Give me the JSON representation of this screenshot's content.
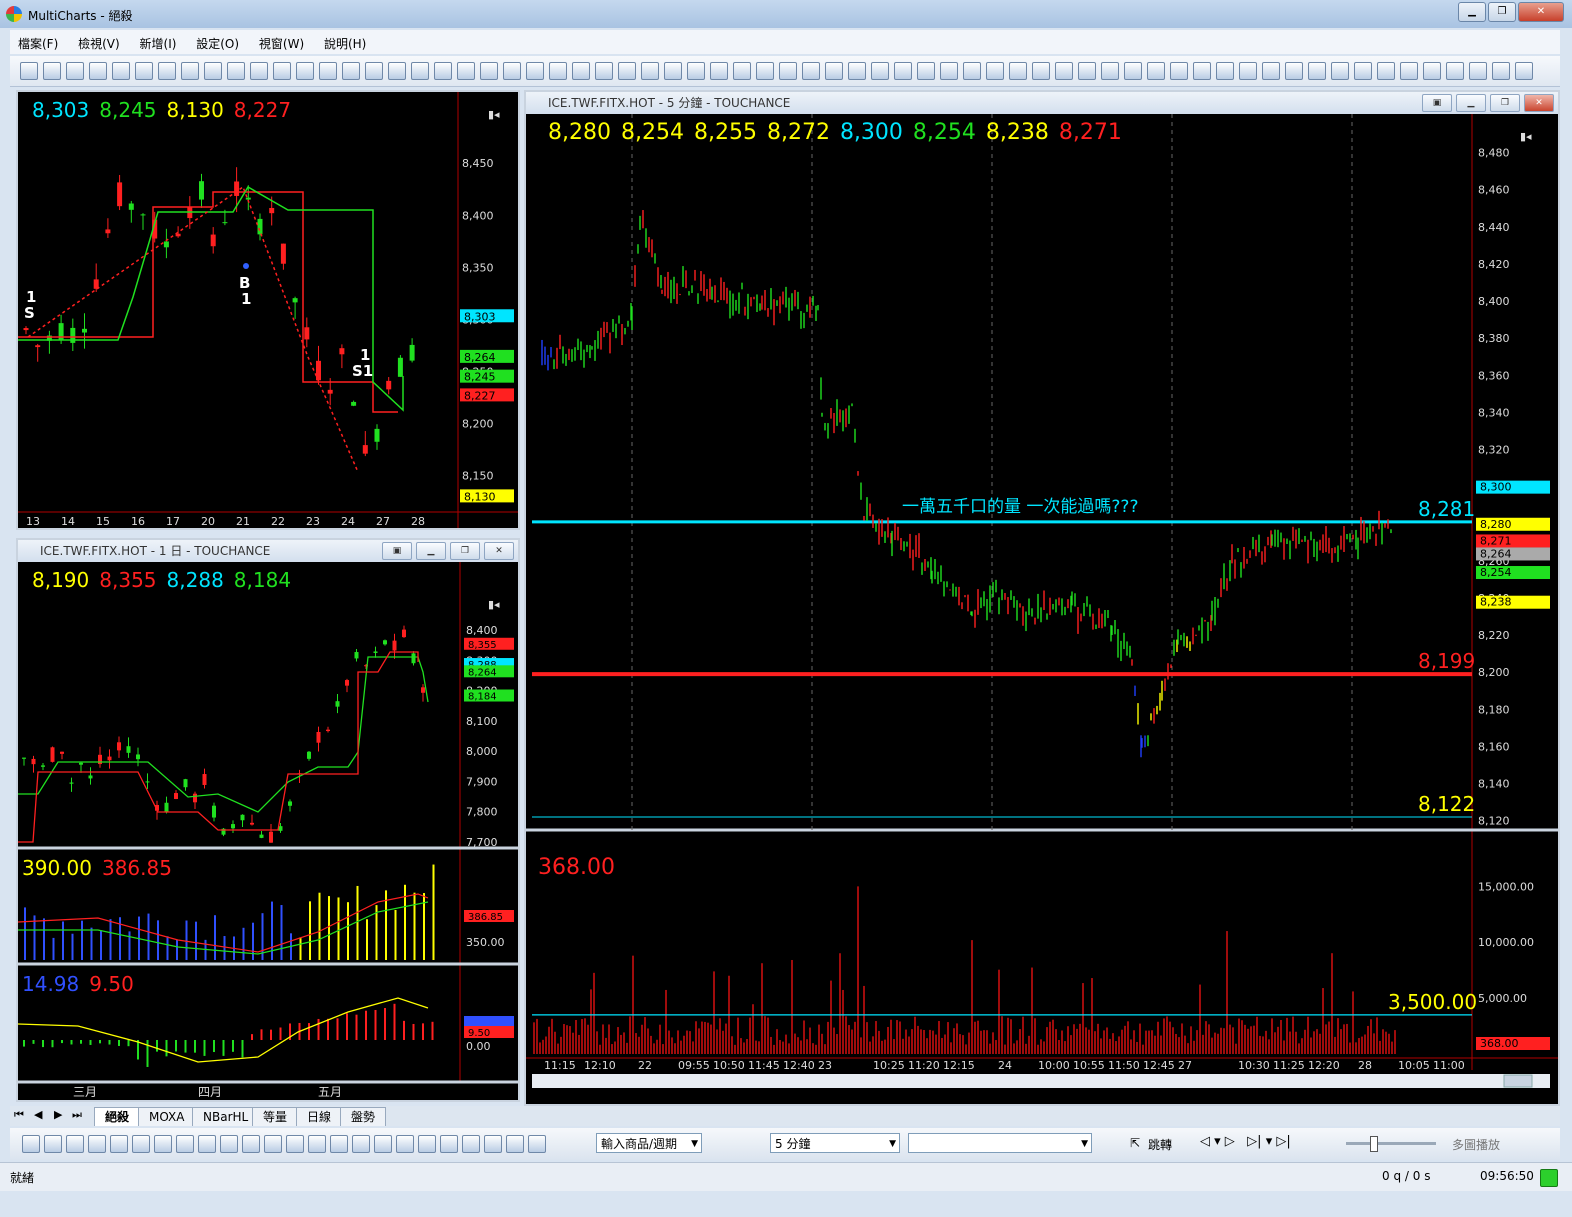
{
  "window": {
    "title": "MultiCharts - 絕殺"
  },
  "menu": [
    "檔案(F)",
    "檢視(V)",
    "新增(I)",
    "設定(O)",
    "視窗(W)",
    "說明(H)"
  ],
  "chart_top_left": {
    "ohlc": [
      "8,303",
      "8,245",
      "8,130",
      "8,227"
    ],
    "ohlc_colors": [
      "#00e5ff",
      "#20e020",
      "#ffff00",
      "#ff2020"
    ],
    "price_ticks": [
      "8,450",
      "8,400",
      "8,350",
      "8,300",
      "8,250",
      "8,200",
      "8,150"
    ],
    "price_tags": [
      "8,303",
      "8,264",
      "8,245",
      "8,227",
      "8,130"
    ],
    "date_ticks": [
      "13",
      "14",
      "15",
      "16",
      "17",
      "20",
      "21",
      "22",
      "23",
      "24",
      "27",
      "28"
    ],
    "signals": [
      "1",
      "S",
      "B",
      "1",
      "1",
      "S1"
    ]
  },
  "chart_daily": {
    "title": "ICE.TWF.FITX.HOT - 1 日 - TOUCHANCE",
    "ohlc": [
      "8,190",
      "8,355",
      "8,288",
      "8,184"
    ],
    "ohlc_colors": [
      "#ffff00",
      "#ff2020",
      "#00e5ff",
      "#20e020"
    ],
    "price_ticks": [
      "8,400",
      "8,300",
      "8,200",
      "8,100",
      "8,000",
      "7,900",
      "7,800",
      "7,700"
    ],
    "price_tags": [
      "8,355",
      "8,288",
      "8,264",
      "8,184"
    ],
    "volume_header": [
      "390.00",
      "386.85"
    ],
    "volume_tags": [
      "386.85"
    ],
    "volume_ticks": [
      "350.00"
    ],
    "osc_header": [
      "14.98",
      "9.50"
    ],
    "osc_tags": [
      "14.98",
      "9.50"
    ],
    "osc_ticks": [
      "0.00"
    ],
    "month_ticks": [
      "三月",
      "四月",
      "五月"
    ]
  },
  "chart_main": {
    "title": "ICE.TWF.FITX.HOT - 5 分鐘 - TOUCHANCE",
    "ohlc": [
      "8,280",
      "8,254",
      "8,255",
      "8,272",
      "8,300",
      "8,254",
      "8,238",
      "8,271"
    ],
    "ohlc_colors": [
      "#ffff00",
      "#ffff00",
      "#ffff00",
      "#ffff00",
      "#00e5ff",
      "#20e020",
      "#ffff00",
      "#ff2020"
    ],
    "price_ticks": [
      "8,480",
      "8,460",
      "8,440",
      "8,420",
      "8,400",
      "8,380",
      "8,360",
      "8,340",
      "8,320",
      "8,300",
      "8,280",
      "8,260",
      "8,240",
      "8,220",
      "8,200",
      "8,180",
      "8,160",
      "8,140",
      "8,120"
    ],
    "price_tags": [
      "8,300",
      "8,280",
      "8,271",
      "8,264",
      "8,254",
      "8,238"
    ],
    "annotation": "一萬五千口的量 一次能過嗎???",
    "hline_labels": [
      "8,281",
      "8,199",
      "8,122"
    ],
    "volume_header": "368.00",
    "volume_ticks": [
      "15,000.00",
      "10,000.00",
      "5,000.00"
    ],
    "volume_line_label": "3,500.00",
    "volume_tag": "368.00",
    "time_ticks": [
      "11:15",
      "12:10",
      "22",
      "09:55",
      "10:50",
      "11:45",
      "12:40",
      "23",
      "10:25",
      "11:20",
      "12:15",
      "24",
      "10:00",
      "10:55",
      "11:50",
      "12:45",
      "27",
      "10:30",
      "11:25",
      "12:20",
      "28",
      "10:05",
      "11:00"
    ]
  },
  "tabs": [
    "絕殺",
    "MOXA",
    "NBarHL",
    "等量",
    "日線",
    "盤勢"
  ],
  "bottom_toolbar": {
    "symbol_combo": "輸入商品/週期",
    "period_combo": "5 分鐘",
    "jump_label": "跳轉",
    "multi_play_label": "多圖播放"
  },
  "status": {
    "ready": "就緒",
    "queue": "0 q / 0 s",
    "time": "09:56:50"
  }
}
